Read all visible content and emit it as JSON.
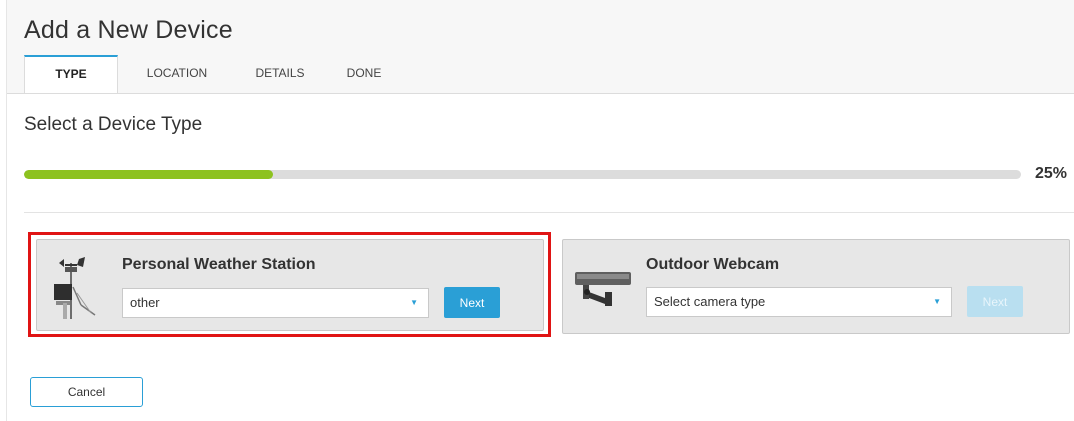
{
  "header": {
    "title": "Add a New Device",
    "tabs": [
      {
        "label": "TYPE",
        "active": true
      },
      {
        "label": "LOCATION",
        "active": false
      },
      {
        "label": "DETAILS",
        "active": false
      },
      {
        "label": "DONE",
        "active": false
      }
    ]
  },
  "main": {
    "section_title": "Select a Device Type",
    "progress": {
      "percent": 25,
      "label": "25%"
    },
    "cards": [
      {
        "title": "Personal Weather Station",
        "icon": "weather-station-icon",
        "select_value": "other",
        "next_label": "Next",
        "next_enabled": true,
        "highlighted": true
      },
      {
        "title": "Outdoor Webcam",
        "icon": "webcam-icon",
        "select_value": "Select camera type",
        "next_label": "Next",
        "next_enabled": false,
        "highlighted": false
      }
    ],
    "cancel_label": "Cancel"
  },
  "colors": {
    "accent": "#2a9fd6",
    "progress_fill": "#8dc21f",
    "highlight_border": "#e01414",
    "card_bg": "#e7e7e7"
  }
}
